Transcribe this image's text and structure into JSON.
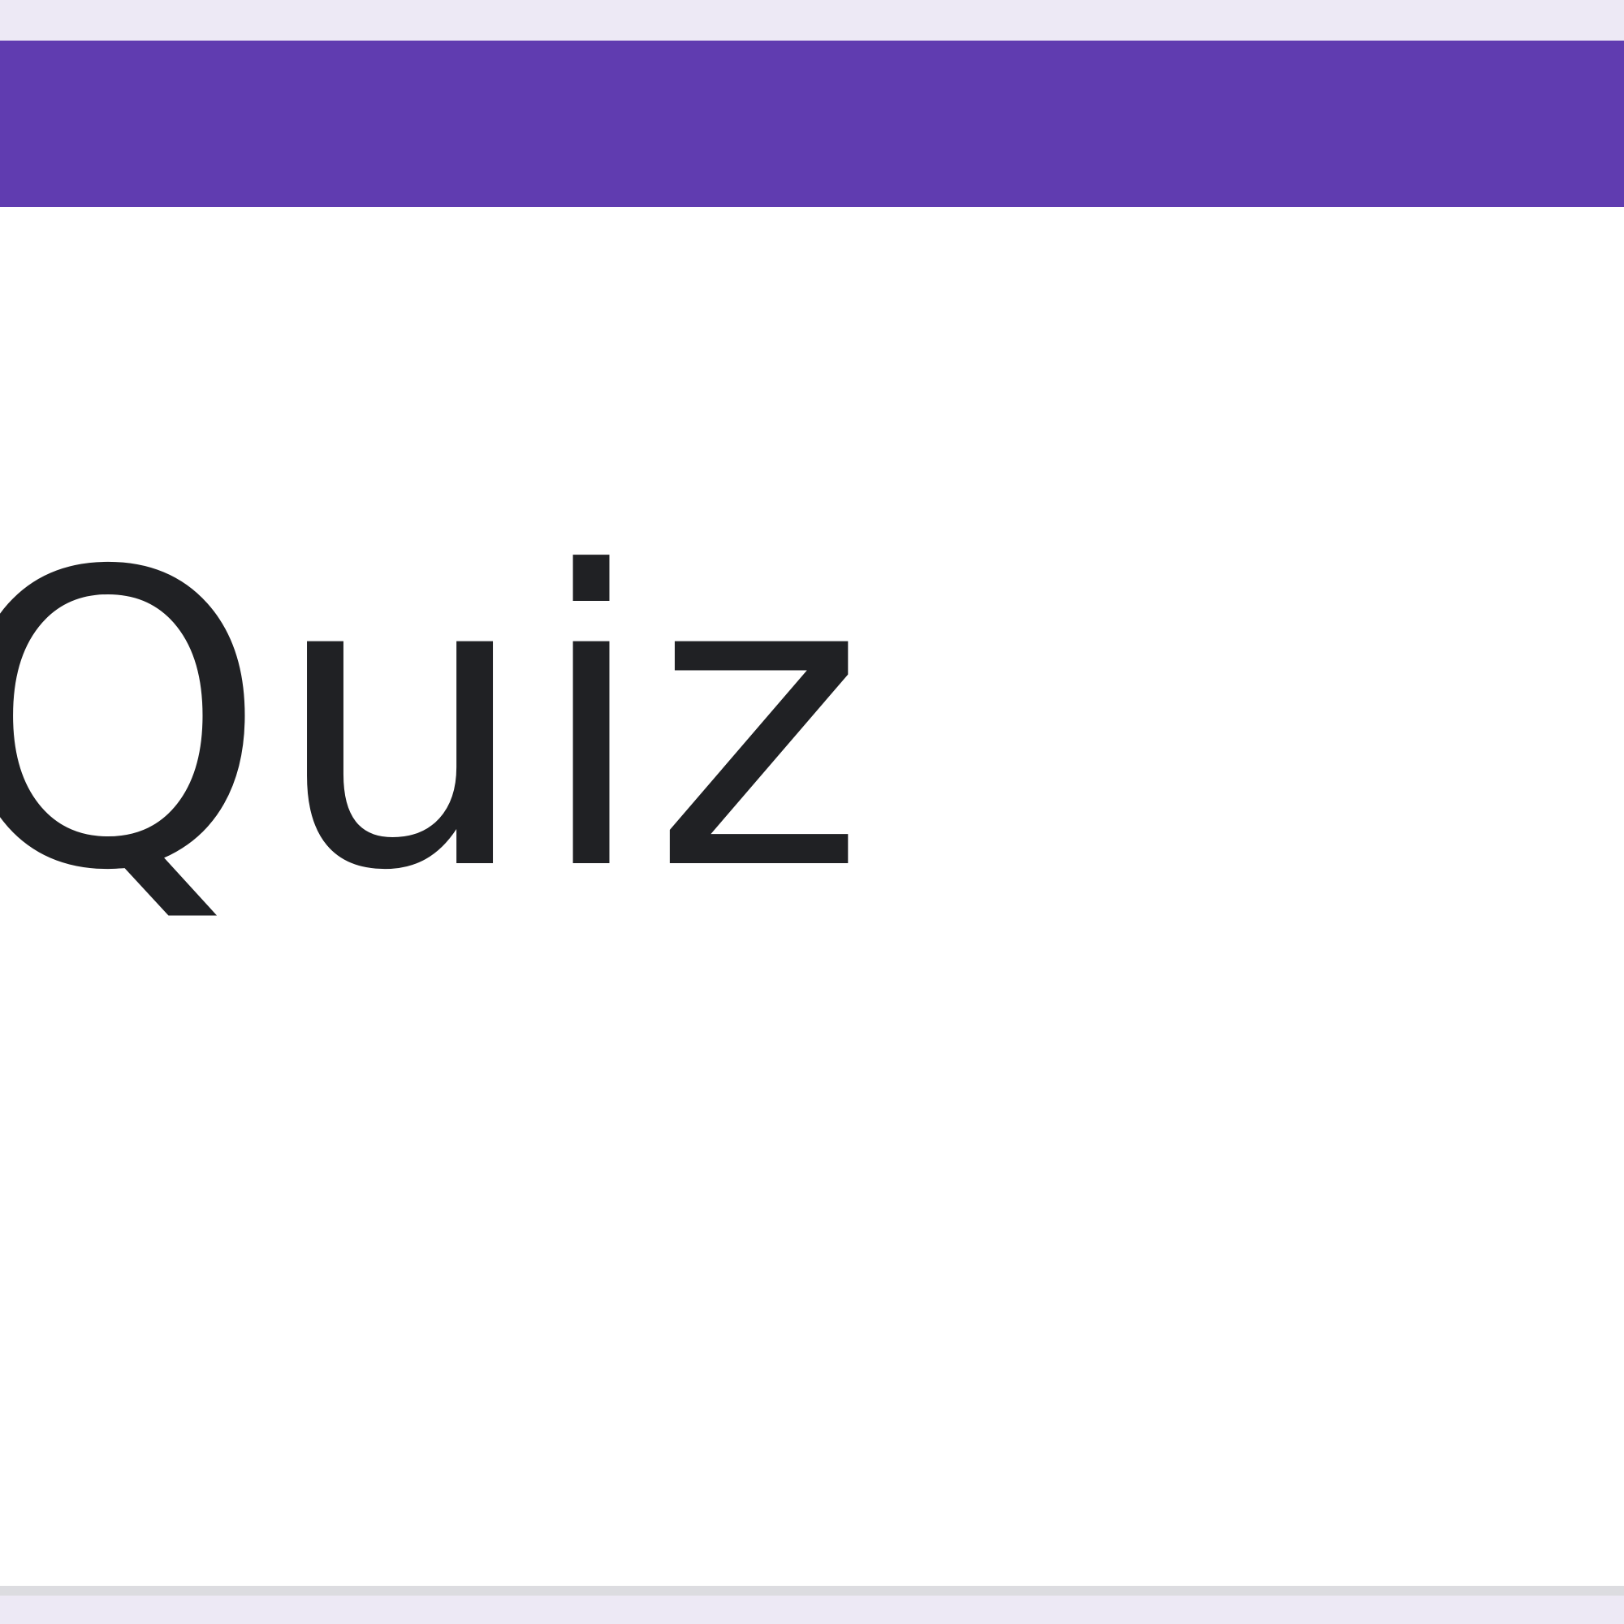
{
  "form": {
    "title": "Quiz",
    "accent_color": "#603cb0"
  },
  "colors": {
    "page_background": "#ede9f5",
    "card_background": "#ffffff",
    "title_text": "#202124"
  }
}
